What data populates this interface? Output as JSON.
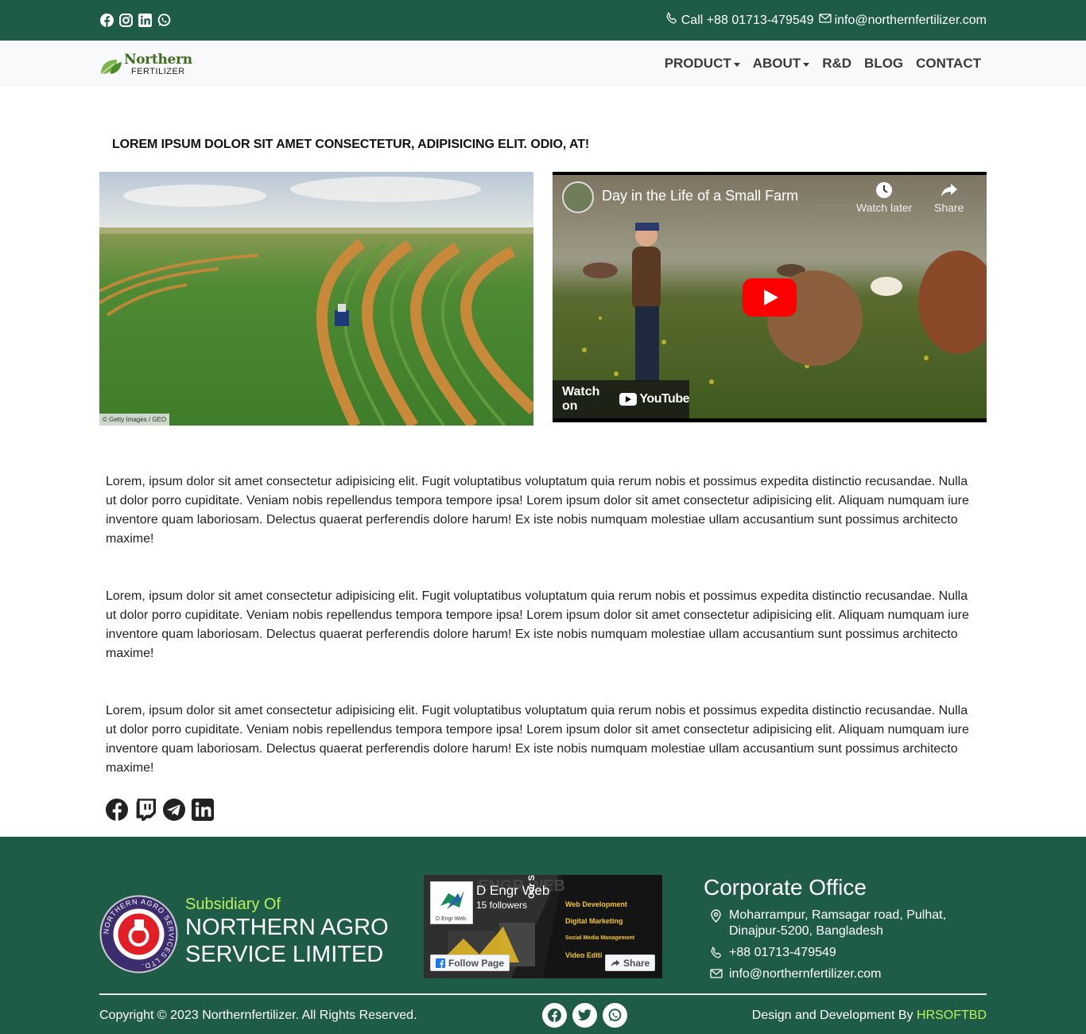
{
  "topbar": {
    "social_icons": [
      "facebook-icon",
      "instagram-icon",
      "linkedin-icon",
      "whatsapp-icon"
    ],
    "phone": "Call +88 01713-479549",
    "email": "info@northernfertilizer.com"
  },
  "navbar": {
    "logo_text_1": "Northern",
    "logo_text_2": "FERTILIZER",
    "menu": [
      {
        "label": "PRODUCT",
        "dropdown": true
      },
      {
        "label": "ABOUT",
        "dropdown": true
      },
      {
        "label": "R&D",
        "dropdown": false
      },
      {
        "label": "BLOG",
        "dropdown": false
      },
      {
        "label": "CONTACT",
        "dropdown": false
      }
    ]
  },
  "main": {
    "headline": "LOREM IPSUM DOLOR SIT AMET CONSECTETUR, ADIPISICING ELIT. ODIO, AT!",
    "image_credit": "© Getty Images / GEO",
    "video": {
      "title": "Day in the Life of a Small Farm",
      "watch_later": "Watch later",
      "share": "Share",
      "watch_on": "Watch on",
      "youtube": "YouTube"
    },
    "paragraphs": [
      "Lorem, ipsum dolor sit amet consectetur adipisicing elit. Fugit voluptatibus voluptatum quia rerum nobis et possimus expedita distinctio recusandae. Nulla ut dolor porro cupiditate. Veniam nobis repellendus tempora tempore ipsa! Lorem ipsum dolor sit amet consectetur adipisicing elit. Aliquam numquam iure inventore quam laboriosam. Delectus quaerat perferendis dolore harum! Ex iste nobis numquam molestiae ullam accusantium sunt possimus architecto maxime!",
      "Lorem, ipsum dolor sit amet consectetur adipisicing elit. Fugit voluptatibus voluptatum quia rerum nobis et possimus expedita distinctio recusandae. Nulla ut dolor porro cupiditate. Veniam nobis repellendus tempora tempore ipsa! Lorem ipsum dolor sit amet consectetur adipisicing elit. Aliquam numquam iure inventore quam laboriosam. Delectus quaerat perferendis dolore harum! Ex iste nobis numquam molestiae ullam accusantium sunt possimus architecto maxime!",
      "Lorem, ipsum dolor sit amet consectetur adipisicing elit. Fugit voluptatibus voluptatum quia rerum nobis et possimus expedita distinctio recusandae. Nulla ut dolor porro cupiditate. Veniam nobis repellendus tempora tempore ipsa! Lorem ipsum dolor sit amet consectetur adipisicing elit. Aliquam numquam iure inventore quam laboriosam. Delectus quaerat perferendis dolore harum! Ex iste nobis numquam molestiae ullam accusantium sunt possimus architecto maxime!"
    ],
    "share_icons": [
      "facebook-icon",
      "twitch-icon",
      "telegram-icon",
      "linkedin-icon"
    ]
  },
  "footer": {
    "seal_text": "NORTHERN AGRO SERVICES LTD.",
    "subsidiary_label": "Subsidiary Of",
    "company_name": "NORTHERN AGRO SERVICE LIMITED",
    "fb_widget": {
      "page_name": "D Engr Web",
      "followers": "15 followers",
      "follow_button": "Follow Page",
      "share_button": "Share",
      "thumb_label": "D Engr Web",
      "banner_heading": "ENGR WEB",
      "services_label": "Our Services",
      "services": [
        "Web Development",
        "Digital Marketing",
        "Social Media Management",
        "Video Editi"
      ]
    },
    "corporate": {
      "title": "Corporate Office",
      "address_line1": "Moharrampur, Ramsagar road, Pulhat,",
      "address_line2": "Dinajpur-5200, Bangladesh",
      "phone": "+88 01713-479549",
      "email": "info@northernfertilizer.com"
    },
    "copyright": "Copyright © 2023 Northernfertilizer. All Rights Reserved.",
    "footer_social_icons": [
      "facebook-icon",
      "twitter-icon",
      "whatsapp-icon"
    ],
    "design_by_label": "Design and Development By",
    "design_by_link": "HRSOFTBD"
  },
  "colors": {
    "brand_green": "#1f5c47",
    "accent_lime": "#b9f15b",
    "navbar_bg": "#f8f9fa"
  }
}
